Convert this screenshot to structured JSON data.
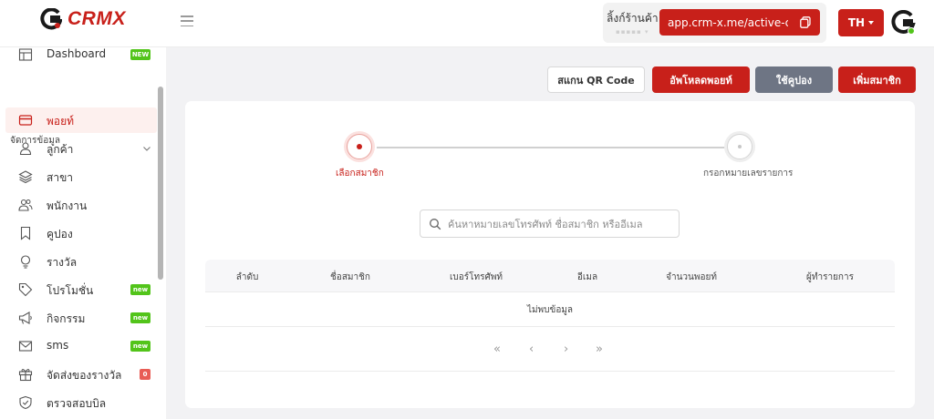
{
  "header": {
    "logo_text": "CRMX",
    "shop_link_label": "ลิ้งก์ร้านค้า",
    "shop_link_sub": "▪▪▪▪▪  ▾",
    "shop_link_url": "app.crm-x.me/active-customer",
    "language": "TH"
  },
  "sidebar": {
    "dashboard": {
      "label": "Dashboard",
      "badge": "NEW"
    },
    "section_title": "จัดการข้อมูล",
    "items": [
      {
        "label": "พอยท์",
        "icon": "credit-card-icon",
        "active": true
      },
      {
        "label": "ลูกค้า",
        "icon": "user-icon",
        "expandable": true
      },
      {
        "label": "สาขา",
        "icon": "layers-icon"
      },
      {
        "label": "พนักงาน",
        "icon": "users-icon"
      },
      {
        "label": "คูปอง",
        "icon": "bookmark-icon"
      },
      {
        "label": "รางวัล",
        "icon": "bulb-icon"
      },
      {
        "label": "โปรโมชั่น",
        "icon": "tag-icon",
        "badge": "new"
      },
      {
        "label": "กิจกรรม",
        "icon": "megaphone-icon",
        "badge": "new"
      },
      {
        "label": "sms",
        "icon": "mail-icon",
        "badge": "new"
      },
      {
        "label": "จัดส่งของรางวัล",
        "icon": "gift-icon",
        "badge": "0"
      },
      {
        "label": "ตรวจสอบบิล",
        "icon": "shield-check-icon"
      }
    ]
  },
  "actions": {
    "scan_qr": "สแกน QR Code",
    "upload_points": "อัพโหลดพอยท์",
    "use_coupon": "ใช้คูปอง",
    "add_member": "เพิ่มสมาชิก"
  },
  "steps": {
    "step1": "เลือกสมาชิก",
    "step2": "กรอกหมายเลขรายการ"
  },
  "search": {
    "placeholder": "ค้นหาหมายเลขโทรศัพท์ ชื่อสมาชิก หรืออีเมล",
    "value": ""
  },
  "table": {
    "columns": [
      "ลำดับ",
      "ชื่อสมาชิก",
      "เบอร์โทรศัพท์",
      "อีเมล",
      "จำนวนพอยท์",
      "ผู้ทำรายการ"
    ],
    "empty_text": "ไม่พบข้อมูล"
  },
  "pagination": {
    "first": "«",
    "prev": "‹",
    "next": "›",
    "last": "»"
  },
  "colors": {
    "brand_red": "#c8201a",
    "coupon_gray": "#6e7584",
    "new_badge_green": "#52c41a",
    "count_badge_red": "#e85c55"
  }
}
